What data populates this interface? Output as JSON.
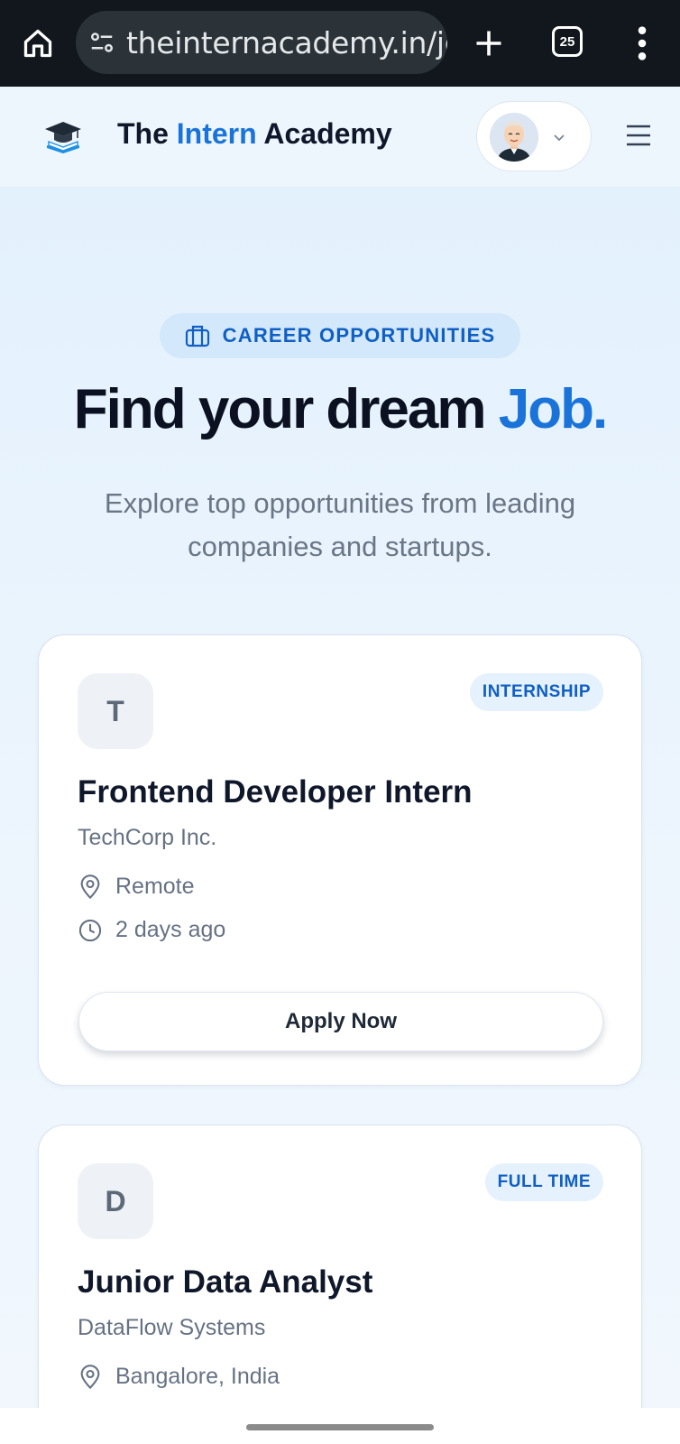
{
  "browser": {
    "url": "theinternacademy.in/jok",
    "tab_count": "25"
  },
  "header": {
    "brand_prefix": "The ",
    "brand_accent": "Intern",
    "brand_suffix": " Academy",
    "accent_color": "#1a73d9"
  },
  "hero": {
    "eyebrow": "CAREER OPPORTUNITIES",
    "headline_main": "Find your dream ",
    "headline_accent": "Job.",
    "subtitle": "Explore top opportunities from leading companies and startups."
  },
  "jobs": [
    {
      "initial": "T",
      "type": "INTERNSHIP",
      "title": "Frontend Developer Intern",
      "company": "TechCorp Inc.",
      "location": "Remote",
      "posted": "2 days ago",
      "apply_label": "Apply Now"
    },
    {
      "initial": "D",
      "type": "FULL TIME",
      "title": "Junior Data Analyst",
      "company": "DataFlow Systems",
      "location": "Bangalore, India"
    }
  ]
}
